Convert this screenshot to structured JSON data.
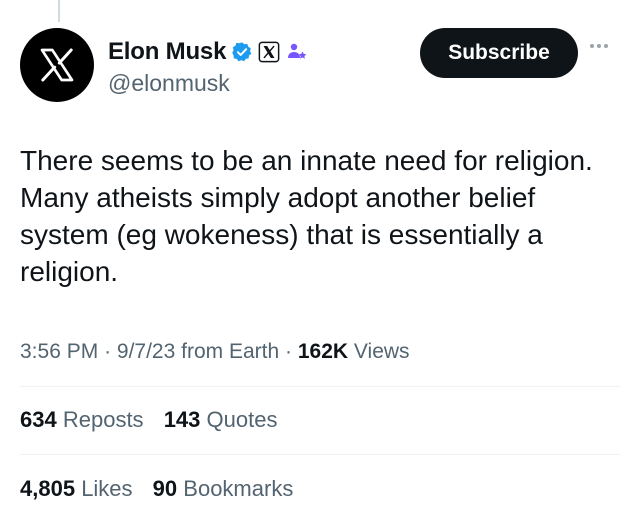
{
  "author": {
    "display_name": "Elon Musk",
    "handle": "@elonmusk",
    "avatar_icon": "x-logo-icon",
    "verified_color": "#1d9bf0",
    "badges": [
      "verified-check-icon",
      "x-affiliate-icon",
      "parody-persons-icon"
    ]
  },
  "actions": {
    "subscribe_label": "Subscribe",
    "more_icon": "more-dots-icon"
  },
  "tweet": {
    "lines": [
      "There seems to be an innate need for religion.",
      "Many atheists simply adopt another belief",
      "system (eg wokeness) that is essentially a",
      "religion."
    ]
  },
  "meta": {
    "time": "3:56 PM",
    "sep1": "·",
    "date": "9/7/23",
    "source": "from Earth",
    "sep2": "·",
    "views_count": "162K",
    "views_label": "Views"
  },
  "engagement": {
    "reposts_count": "634",
    "reposts_label": "Reposts",
    "quotes_count": "143",
    "quotes_label": "Quotes",
    "likes_count": "4,805",
    "likes_label": "Likes",
    "bookmarks_count": "90",
    "bookmarks_label": "Bookmarks"
  },
  "colors": {
    "text": "#0f1419",
    "secondary": "#536471",
    "button_bg": "#0f1419",
    "badge_purple": "#7856ff"
  }
}
